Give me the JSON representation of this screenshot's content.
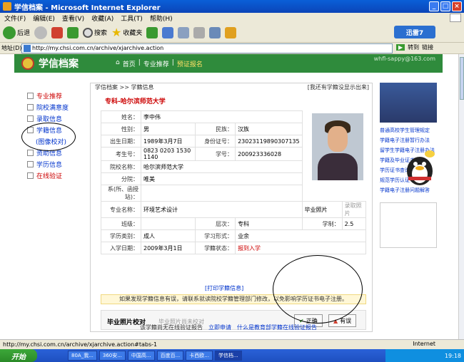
{
  "window": {
    "title": "学信档案 - Microsoft Internet Explorer"
  },
  "menu": [
    "文件(F)",
    "编辑(E)",
    "查看(V)",
    "收藏(A)",
    "工具(T)",
    "帮助(H)"
  ],
  "toolbar": {
    "back": "后退",
    "search": "搜索",
    "favorites": "收藏夹",
    "xunlei": "迅雷7"
  },
  "address": {
    "label": "地址(D)",
    "url": "http://my.chsi.com.cn/archive/xjarchive.action",
    "go": "转到",
    "links": "链接"
  },
  "header": {
    "logo": "学信档案",
    "home": "首页",
    "nav2": "专业推荐",
    "nav3": "预证报名",
    "email": "whfl-sappy@163.com"
  },
  "leftnav": [
    {
      "label": "专业推荐",
      "red": true
    },
    {
      "label": "院校满意度",
      "red": false
    },
    {
      "label": "录取信息",
      "red": false
    },
    {
      "label": "学籍信息",
      "red": false
    },
    {
      "label": "(图像校对)",
      "red": false
    },
    {
      "label": "资助信息",
      "red": false
    },
    {
      "label": "学历信息",
      "red": false
    },
    {
      "label": "在线验证",
      "red": true
    }
  ],
  "main": {
    "breadcrumb": "学信档案 >> 学籍信息",
    "right_link": "[我还有学籍没显示出来]",
    "title": "专科-哈尔滨师范大学",
    "rows": {
      "name_l": "姓名：",
      "name": "李中伟",
      "gender_l": "性别：",
      "gender": "男",
      "nation_l": "民族：",
      "nation": "汉族",
      "birth_l": "出生日期：",
      "birth": "1989年3月7日",
      "id_l": "身份证号：",
      "id": "23023119890307135",
      "exam_l": "考生号：",
      "exam": "0823 0203 1530 1140",
      "sno_l": "学号：",
      "sno": "200923336028",
      "school_l": "院校名称：",
      "school": "哈尔滨师范大学",
      "branch_l": "分院：",
      "branch": "唯美",
      "dept_l": "系(所、函授站)：",
      "dept": "",
      "major_l": "专业名称：",
      "major": "环境艺术设计",
      "photo_l": "毕业照片",
      "photo_btn": "录取照片",
      "class_l": "班级：",
      "class": "",
      "level_l": "层次：",
      "level": "专科",
      "dur_l": "学制：",
      "dur": "2.5",
      "type_l": "学历类别：",
      "type": "成人",
      "form_l": "学习形式：",
      "form": "业余",
      "enroll_l": "入学日期：",
      "enroll": "2009年3月1日",
      "status_l": "学籍状态：",
      "status": "报到入学"
    },
    "print": "[打印学籍信息]",
    "notice": "如果发现学籍信息有误，请联系就读院校学籍管理部门修改，以免影响学历证书电子注册。",
    "verify_title": "毕业照片校对",
    "verify_hint": "毕业照片尚未校对",
    "ok": "正确",
    "err": "有误"
  },
  "bottom": {
    "text": "该学籍尚无在线验证报告",
    "apply": "立即申请",
    "what": "什么是教育部学籍在线验证报告"
  },
  "rightlinks": [
    "普通高校学生管理规定",
    "学籍电子注册暂行办法",
    "留学生学籍电子注册办法",
    "学籍及毕业证书办理",
    "学历证书查询",
    "规范学历认证",
    "学籍电子注册问题解答"
  ],
  "status": {
    "url": "http://my.chsi.com.cn/archive/xjarchive.action#tabs-1",
    "zone": "Internet"
  },
  "taskbar": {
    "start": "开始",
    "items": [
      "80A_我...",
      "360安...",
      "中国高...",
      "百度百...",
      "卡西欧...",
      "学信档..."
    ],
    "clock": "19:18"
  }
}
